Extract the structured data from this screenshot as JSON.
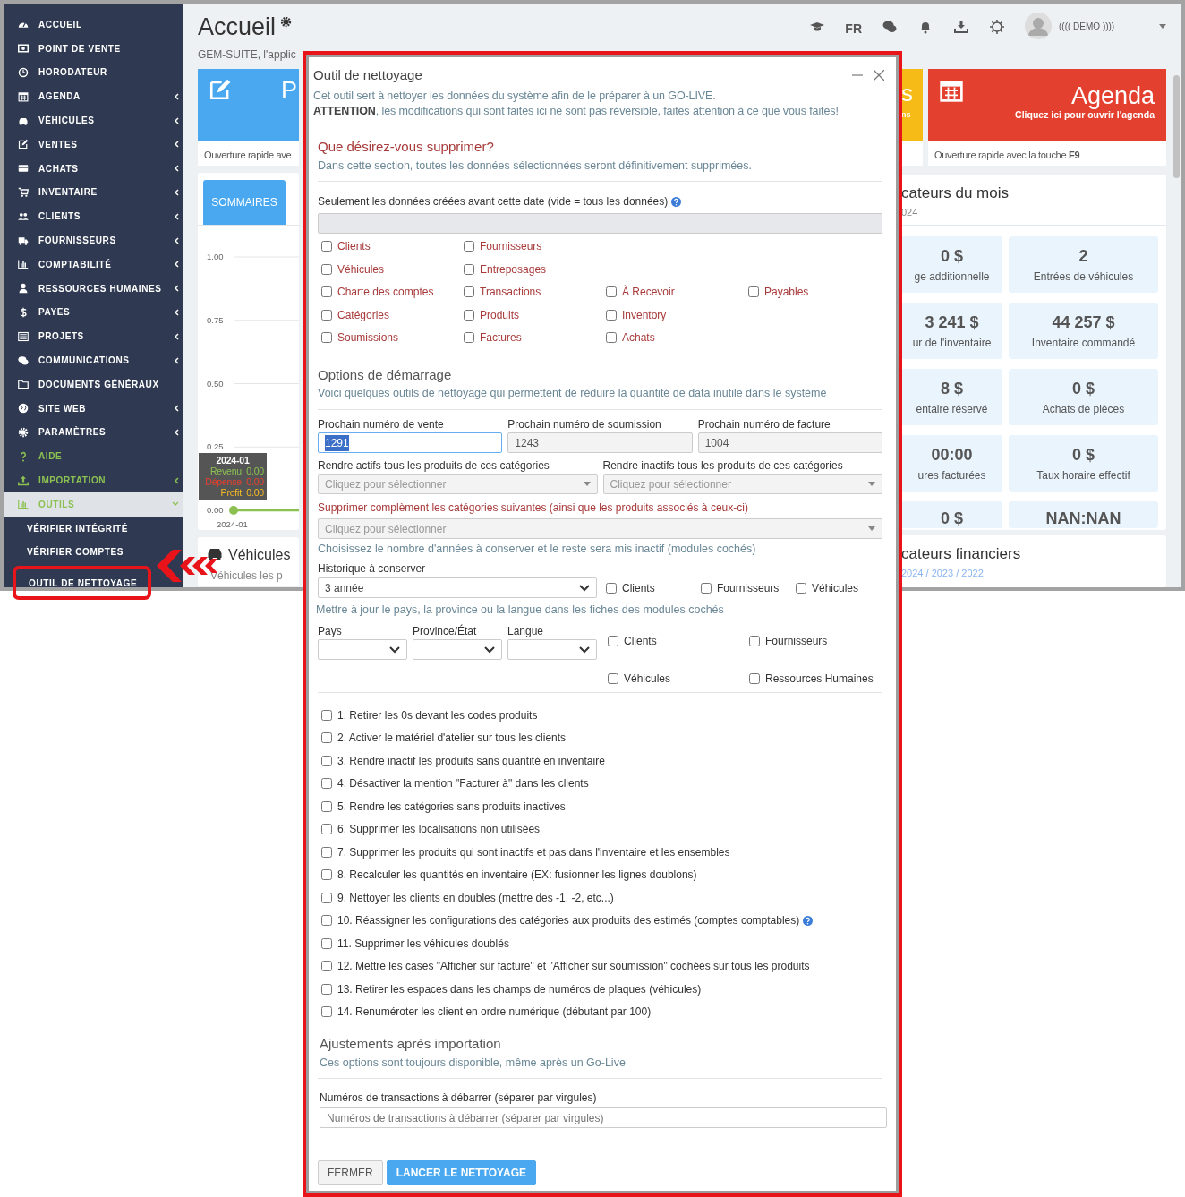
{
  "annotations": {
    "dialog_frame": true,
    "pointer_arrow": true
  },
  "sidebar": {
    "items": [
      {
        "label": "ACCUEIL",
        "submenu": false,
        "expanded": false,
        "accent": false
      },
      {
        "label": "POINT DE VENTE",
        "submenu": false,
        "expanded": false,
        "accent": false
      },
      {
        "label": "HORODATEUR",
        "submenu": false,
        "expanded": false,
        "accent": false
      },
      {
        "label": "AGENDA",
        "submenu": true,
        "expanded": false,
        "accent": false
      },
      {
        "label": "VÉHICULES",
        "submenu": true,
        "expanded": false,
        "accent": false
      },
      {
        "label": "VENTES",
        "submenu": true,
        "expanded": false,
        "accent": false
      },
      {
        "label": "ACHATS",
        "submenu": true,
        "expanded": false,
        "accent": false
      },
      {
        "label": "INVENTAIRE",
        "submenu": true,
        "expanded": false,
        "accent": false
      },
      {
        "label": "CLIENTS",
        "submenu": true,
        "expanded": false,
        "accent": false
      },
      {
        "label": "FOURNISSEURS",
        "submenu": true,
        "expanded": false,
        "accent": false
      },
      {
        "label": "COMPTABILITÉ",
        "submenu": true,
        "expanded": false,
        "accent": false
      },
      {
        "label": "RESSOURCES HUMAINES",
        "submenu": true,
        "expanded": false,
        "accent": false
      },
      {
        "label": "PAYES",
        "submenu": true,
        "expanded": false,
        "accent": false
      },
      {
        "label": "PROJETS",
        "submenu": true,
        "expanded": false,
        "accent": false
      },
      {
        "label": "COMMUNICATIONS",
        "submenu": true,
        "expanded": false,
        "accent": false
      },
      {
        "label": "DOCUMENTS GÉNÉRAUX",
        "submenu": false,
        "expanded": false,
        "accent": false
      },
      {
        "label": "SITE WEB",
        "submenu": true,
        "expanded": false,
        "accent": false
      },
      {
        "label": "PARAMÈTRES",
        "submenu": true,
        "expanded": false,
        "accent": false
      },
      {
        "label": "AIDE",
        "submenu": false,
        "expanded": false,
        "accent": true
      },
      {
        "label": "IMPORTATION",
        "submenu": true,
        "expanded": false,
        "accent": true
      },
      {
        "label": "OUTILS",
        "submenu": true,
        "expanded": true,
        "accent": true,
        "children": [
          {
            "label": "VÉRIFIER INTÉGRITÉ",
            "selected": false
          },
          {
            "label": "VÉRIFIER COMPTES",
            "selected": false
          },
          {
            "label": "OUTIL DE NETTOYAGE",
            "selected": true
          }
        ]
      }
    ]
  },
  "header": {
    "title": "Accueil",
    "subtitle": "GEM-SUITE, l'applic",
    "language": "FR",
    "user": "(((( DEMO ))))"
  },
  "left_column": {
    "quick_card": {
      "title": "P",
      "footer": "Ouverture rapide ave"
    },
    "summary_panel": {
      "tabs": [
        {
          "label": "SOMMAIRES",
          "selected": true
        }
      ],
      "chart_data": {
        "type": "line",
        "categories": [
          "2024-01"
        ],
        "grid": true,
        "series": [
          {
            "color": "#8cc152",
            "marker": true,
            "values": [
              0
            ]
          }
        ],
        "ylim": [
          0,
          1
        ],
        "yticks": [
          {
            "value": 0,
            "label": "0.00"
          },
          {
            "value": 0.25,
            "label": "0.25"
          },
          {
            "value": 0.5,
            "label": "0.50"
          },
          {
            "value": 0.75,
            "label": "0.75"
          },
          {
            "value": 1,
            "label": "1.00"
          }
        ]
      },
      "tooltip": {
        "title": "2024-01",
        "lines": [
          {
            "text": "Revenu: 0.00",
            "color": "#8cc152"
          },
          {
            "text": "Dépense: 0.00",
            "color": "#e8412f"
          },
          {
            "text": "Profit: 0.00",
            "color": "#f6bb22"
          }
        ]
      }
    },
    "vehicles_panel": {
      "title": "Véhicules",
      "subtitle": "Véhicules les p"
    }
  },
  "right_column": {
    "partial_card": {
      "title": "s",
      "subtitle": "ns"
    },
    "agenda_card": {
      "title": "Agenda",
      "subtitle": "Cliquez ici pour ouvrir l'agenda",
      "footer": "Ouverture rapide avec la touche **F9**"
    },
    "month_panel": {
      "title": "cateurs du mois",
      "subtitle": "024",
      "stats": [
        [
          {
            "value": "0 $",
            "label": "ge additionnelle"
          },
          {
            "value": "2",
            "label": "Entrées de véhicules"
          }
        ],
        [
          {
            "value": "3 241 $",
            "label": "ur de l'inventaire"
          },
          {
            "value": "44 257 $",
            "label": "Inventaire commandé"
          }
        ],
        [
          {
            "value": "8 $",
            "label": "entaire réservé"
          },
          {
            "value": "0 $",
            "label": "Achats de pièces"
          }
        ],
        [
          {
            "value": "00:00",
            "label": "ures facturées"
          },
          {
            "value": "0 $",
            "label": "Taux horaire effectif"
          }
        ],
        [
          {
            "value": "0 $"
          },
          {
            "value": "NAN:NAN"
          }
        ]
      ]
    },
    "financial_panel": {
      "title": "cateurs financiers",
      "subtitle": "2024 / 2023 / 2022"
    }
  },
  "dialog": {
    "title": "Outil de nettoyage",
    "intro": [
      "Cet outil sert à nettoyer les données du système afin de le préparer à un GO-LIVE.",
      "**ATTENTION**, les modifications qui sont faites ici ne sont pas réversible, faites attention à ce que vous faites!"
    ],
    "delete_section": {
      "heading": "Que désirez-vous supprimer?",
      "description": "Dans cette section, toutes les données sélectionnées seront définitivement supprimées.",
      "date_label": "Seulement les données créées avant cette date (vide = tous les données)",
      "options": [
        [
          {
            "label": "Clients",
            "checked": false
          },
          {
            "label": "Fournisseurs",
            "checked": false
          }
        ],
        [
          {
            "label": "Véhicules",
            "checked": false
          },
          {
            "label": "Entreposages",
            "checked": false
          }
        ],
        [
          {
            "label": "Charte des comptes",
            "checked": false
          },
          {
            "label": "Transactions",
            "checked": false
          },
          {
            "label": "À Recevoir",
            "checked": false
          },
          {
            "label": "Payables",
            "checked": false
          }
        ],
        [
          {
            "label": "Catégories",
            "checked": false
          },
          {
            "label": "Produits",
            "checked": false
          },
          {
            "label": "Inventory",
            "checked": false
          }
        ],
        [
          {
            "label": "Soumissions",
            "checked": false
          },
          {
            "label": "Factures",
            "checked": false
          },
          {
            "label": "Achats",
            "checked": false
          }
        ]
      ]
    },
    "startup_section": {
      "heading": "Options de démarrage",
      "description": "Voici quelques outils de nettoyage qui permettent de réduire la quantité de data inutile dans le système",
      "number_fields": [
        {
          "label": "Prochain numéro de vente",
          "value": "1291",
          "focused": true
        },
        {
          "label": "Prochain numéro de soumission",
          "value": "1243",
          "focused": false
        },
        {
          "label": "Prochain numéro de facture",
          "value": "1004",
          "focused": false
        }
      ],
      "category_selects": [
        {
          "label": "Rendre actifs tous les produits de ces catégories",
          "placeholder": "Cliquez pour sélectionner"
        },
        {
          "label": "Rendre inactifs tous les produits de ces catégories",
          "placeholder": "Cliquez pour sélectionner"
        }
      ],
      "delete_categories": {
        "label": "Supprimer complèment les catégories suivantes (ainsi que les produits associés à ceux-ci)",
        "placeholder": "Cliquez pour sélectionner"
      },
      "history_note": "Choisissez le nombre d'années à conserver et le reste sera mis inactif (modules cochés)",
      "history": {
        "label": "Historique à conserver",
        "value": "3 année",
        "modules": [
          {
            "label": "Clients",
            "checked": false
          },
          {
            "label": "Fournisseurs",
            "checked": false
          },
          {
            "label": "Véhicules",
            "checked": false
          }
        ]
      },
      "update_note": "Mettre à jour le pays, la province ou la langue dans les fiches des modules cochés",
      "location_selects": [
        {
          "label": "Pays"
        },
        {
          "label": "Province/État"
        },
        {
          "label": "Langue"
        }
      ],
      "update_modules": [
        {
          "label": "Clients",
          "checked": false
        },
        {
          "label": "Fournisseurs",
          "checked": false
        },
        {
          "label": "Véhicules",
          "checked": false
        },
        {
          "label": "Ressources Humaines",
          "checked": false
        }
      ],
      "tasks": [
        {
          "label": "1. Retirer les 0s devant les codes produits",
          "checked": false,
          "help": false
        },
        {
          "label": "2. Activer le matériel d'atelier sur tous les clients",
          "checked": false,
          "help": false
        },
        {
          "label": "3. Rendre inactif les produits sans quantité en inventaire",
          "checked": false,
          "help": false
        },
        {
          "label": "4. Désactiver la mention \"Facturer à\" dans les clients",
          "checked": false,
          "help": false
        },
        {
          "label": "5. Rendre les catégories sans produits inactives",
          "checked": false,
          "help": false
        },
        {
          "label": "6. Supprimer les localisations non utilisées",
          "checked": false,
          "help": false
        },
        {
          "label": "7. Supprimer les produits qui sont inactifs et pas dans l'inventaire et les ensembles",
          "checked": false,
          "help": false
        },
        {
          "label": "8. Recalculer les quantités en inventaire (EX: fusionner les lignes doublons)",
          "checked": false,
          "help": false
        },
        {
          "label": "9. Nettoyer les clients en doubles (mettre des -1, -2, etc...)",
          "checked": false,
          "help": false
        },
        {
          "label": "10. Réassigner les configurations des catégories aux produits des estimés (comptes comptables)",
          "checked": false,
          "help": true
        },
        {
          "label": "11. Supprimer les véhicules doublés",
          "checked": false,
          "help": false
        },
        {
          "label": "12. Mettre les cases \"Afficher sur facture\" et \"Afficher sur soumission\" cochées sur tous les produits",
          "checked": false,
          "help": false
        },
        {
          "label": "13. Retirer les espaces dans les champs de numéros de plaques (véhicules)",
          "checked": false,
          "help": false
        },
        {
          "label": "14. Renuméroter les client en ordre numérique (débutant par 100)",
          "checked": false,
          "help": false
        }
      ]
    },
    "import_section": {
      "heading": "Ajustements après importation",
      "description": "Ces options sont toujours disponible, même après un Go-Live",
      "field": {
        "label": "Numéros de transactions à débarrer (séparer par virgules)",
        "placeholder": "Numéros de transactions à débarrer (séparer par virgules)"
      }
    },
    "buttons": [
      {
        "label": "FERMER",
        "kind": "secondary"
      },
      {
        "label": "LANCER LE NETTOYAGE",
        "kind": "primary"
      }
    ]
  }
}
